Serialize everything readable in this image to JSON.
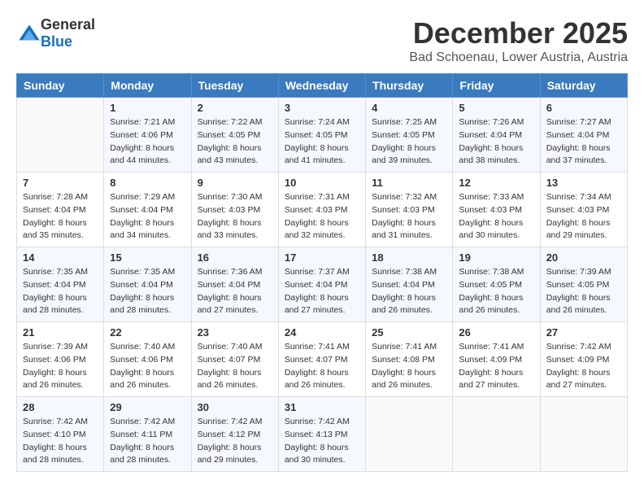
{
  "logo": {
    "general": "General",
    "blue": "Blue"
  },
  "title": {
    "month": "December 2025",
    "location": "Bad Schoenau, Lower Austria, Austria"
  },
  "weekdays": [
    "Sunday",
    "Monday",
    "Tuesday",
    "Wednesday",
    "Thursday",
    "Friday",
    "Saturday"
  ],
  "weeks": [
    [
      {
        "day": "",
        "info": ""
      },
      {
        "day": "1",
        "info": "Sunrise: 7:21 AM\nSunset: 4:06 PM\nDaylight: 8 hours\nand 44 minutes."
      },
      {
        "day": "2",
        "info": "Sunrise: 7:22 AM\nSunset: 4:05 PM\nDaylight: 8 hours\nand 43 minutes."
      },
      {
        "day": "3",
        "info": "Sunrise: 7:24 AM\nSunset: 4:05 PM\nDaylight: 8 hours\nand 41 minutes."
      },
      {
        "day": "4",
        "info": "Sunrise: 7:25 AM\nSunset: 4:05 PM\nDaylight: 8 hours\nand 39 minutes."
      },
      {
        "day": "5",
        "info": "Sunrise: 7:26 AM\nSunset: 4:04 PM\nDaylight: 8 hours\nand 38 minutes."
      },
      {
        "day": "6",
        "info": "Sunrise: 7:27 AM\nSunset: 4:04 PM\nDaylight: 8 hours\nand 37 minutes."
      }
    ],
    [
      {
        "day": "7",
        "info": "Sunrise: 7:28 AM\nSunset: 4:04 PM\nDaylight: 8 hours\nand 35 minutes."
      },
      {
        "day": "8",
        "info": "Sunrise: 7:29 AM\nSunset: 4:04 PM\nDaylight: 8 hours\nand 34 minutes."
      },
      {
        "day": "9",
        "info": "Sunrise: 7:30 AM\nSunset: 4:03 PM\nDaylight: 8 hours\nand 33 minutes."
      },
      {
        "day": "10",
        "info": "Sunrise: 7:31 AM\nSunset: 4:03 PM\nDaylight: 8 hours\nand 32 minutes."
      },
      {
        "day": "11",
        "info": "Sunrise: 7:32 AM\nSunset: 4:03 PM\nDaylight: 8 hours\nand 31 minutes."
      },
      {
        "day": "12",
        "info": "Sunrise: 7:33 AM\nSunset: 4:03 PM\nDaylight: 8 hours\nand 30 minutes."
      },
      {
        "day": "13",
        "info": "Sunrise: 7:34 AM\nSunset: 4:03 PM\nDaylight: 8 hours\nand 29 minutes."
      }
    ],
    [
      {
        "day": "14",
        "info": "Sunrise: 7:35 AM\nSunset: 4:04 PM\nDaylight: 8 hours\nand 28 minutes."
      },
      {
        "day": "15",
        "info": "Sunrise: 7:35 AM\nSunset: 4:04 PM\nDaylight: 8 hours\nand 28 minutes."
      },
      {
        "day": "16",
        "info": "Sunrise: 7:36 AM\nSunset: 4:04 PM\nDaylight: 8 hours\nand 27 minutes."
      },
      {
        "day": "17",
        "info": "Sunrise: 7:37 AM\nSunset: 4:04 PM\nDaylight: 8 hours\nand 27 minutes."
      },
      {
        "day": "18",
        "info": "Sunrise: 7:38 AM\nSunset: 4:04 PM\nDaylight: 8 hours\nand 26 minutes."
      },
      {
        "day": "19",
        "info": "Sunrise: 7:38 AM\nSunset: 4:05 PM\nDaylight: 8 hours\nand 26 minutes."
      },
      {
        "day": "20",
        "info": "Sunrise: 7:39 AM\nSunset: 4:05 PM\nDaylight: 8 hours\nand 26 minutes."
      }
    ],
    [
      {
        "day": "21",
        "info": "Sunrise: 7:39 AM\nSunset: 4:06 PM\nDaylight: 8 hours\nand 26 minutes."
      },
      {
        "day": "22",
        "info": "Sunrise: 7:40 AM\nSunset: 4:06 PM\nDaylight: 8 hours\nand 26 minutes."
      },
      {
        "day": "23",
        "info": "Sunrise: 7:40 AM\nSunset: 4:07 PM\nDaylight: 8 hours\nand 26 minutes."
      },
      {
        "day": "24",
        "info": "Sunrise: 7:41 AM\nSunset: 4:07 PM\nDaylight: 8 hours\nand 26 minutes."
      },
      {
        "day": "25",
        "info": "Sunrise: 7:41 AM\nSunset: 4:08 PM\nDaylight: 8 hours\nand 26 minutes."
      },
      {
        "day": "26",
        "info": "Sunrise: 7:41 AM\nSunset: 4:09 PM\nDaylight: 8 hours\nand 27 minutes."
      },
      {
        "day": "27",
        "info": "Sunrise: 7:42 AM\nSunset: 4:09 PM\nDaylight: 8 hours\nand 27 minutes."
      }
    ],
    [
      {
        "day": "28",
        "info": "Sunrise: 7:42 AM\nSunset: 4:10 PM\nDaylight: 8 hours\nand 28 minutes."
      },
      {
        "day": "29",
        "info": "Sunrise: 7:42 AM\nSunset: 4:11 PM\nDaylight: 8 hours\nand 28 minutes."
      },
      {
        "day": "30",
        "info": "Sunrise: 7:42 AM\nSunset: 4:12 PM\nDaylight: 8 hours\nand 29 minutes."
      },
      {
        "day": "31",
        "info": "Sunrise: 7:42 AM\nSunset: 4:13 PM\nDaylight: 8 hours\nand 30 minutes."
      },
      {
        "day": "",
        "info": ""
      },
      {
        "day": "",
        "info": ""
      },
      {
        "day": "",
        "info": ""
      }
    ]
  ]
}
